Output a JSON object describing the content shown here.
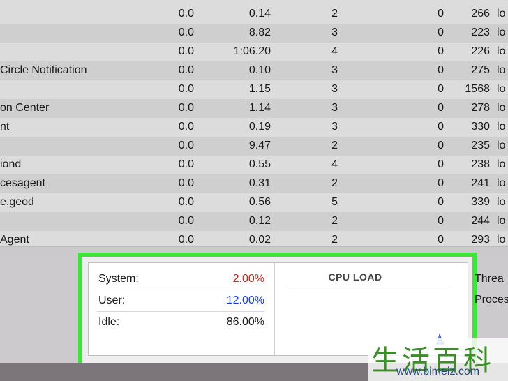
{
  "process_table": {
    "rows": [
      {
        "name": "",
        "cpu": "0.0",
        "time": "0.14",
        "threads": "2",
        "idle_wake": "0",
        "pid": "266",
        "user": "lo"
      },
      {
        "name": "",
        "cpu": "0.0",
        "time": "8.82",
        "threads": "3",
        "idle_wake": "0",
        "pid": "223",
        "user": "lo"
      },
      {
        "name": "",
        "cpu": "0.0",
        "time": "1:06.20",
        "threads": "4",
        "idle_wake": "0",
        "pid": "226",
        "user": "lo"
      },
      {
        "name": "Circle Notification",
        "cpu": "0.0",
        "time": "0.10",
        "threads": "3",
        "idle_wake": "0",
        "pid": "275",
        "user": "lo"
      },
      {
        "name": "",
        "cpu": "0.0",
        "time": "1.15",
        "threads": "3",
        "idle_wake": "0",
        "pid": "1568",
        "user": "lo"
      },
      {
        "name": "on Center",
        "cpu": "0.0",
        "time": "1.14",
        "threads": "3",
        "idle_wake": "0",
        "pid": "278",
        "user": "lo"
      },
      {
        "name": "nt",
        "cpu": "0.0",
        "time": "0.19",
        "threads": "3",
        "idle_wake": "0",
        "pid": "330",
        "user": "lo"
      },
      {
        "name": "",
        "cpu": "0.0",
        "time": "9.47",
        "threads": "2",
        "idle_wake": "0",
        "pid": "235",
        "user": "lo"
      },
      {
        "name": "iond",
        "cpu": "0.0",
        "time": "0.55",
        "threads": "4",
        "idle_wake": "0",
        "pid": "238",
        "user": "lo"
      },
      {
        "name": "cesagent",
        "cpu": "0.0",
        "time": "0.31",
        "threads": "2",
        "idle_wake": "0",
        "pid": "241",
        "user": "lo"
      },
      {
        "name": "e.geod",
        "cpu": "0.0",
        "time": "0.56",
        "threads": "5",
        "idle_wake": "0",
        "pid": "339",
        "user": "lo"
      },
      {
        "name": "",
        "cpu": "0.0",
        "time": "0.12",
        "threads": "2",
        "idle_wake": "0",
        "pid": "244",
        "user": "lo"
      },
      {
        "name": "Agent",
        "cpu": "0.0",
        "time": "0.02",
        "threads": "2",
        "idle_wake": "0",
        "pid": "293",
        "user": "lo"
      }
    ]
  },
  "cpu_stats": {
    "system_label": "System:",
    "system_value": "2.00%",
    "user_label": "User:",
    "user_value": "12.00%",
    "idle_label": "Idle:",
    "idle_value": "86.00%"
  },
  "cpu_load": {
    "title": "CPU LOAD"
  },
  "side_stats": {
    "threads_label": "Threa",
    "processes_label": "Proces"
  },
  "watermark": {
    "chinese": "生活百科",
    "url": "www.bimeiz.com"
  },
  "colors": {
    "system": "#d02020",
    "user": "#1a3fd0",
    "highlight": "#3de43a"
  }
}
